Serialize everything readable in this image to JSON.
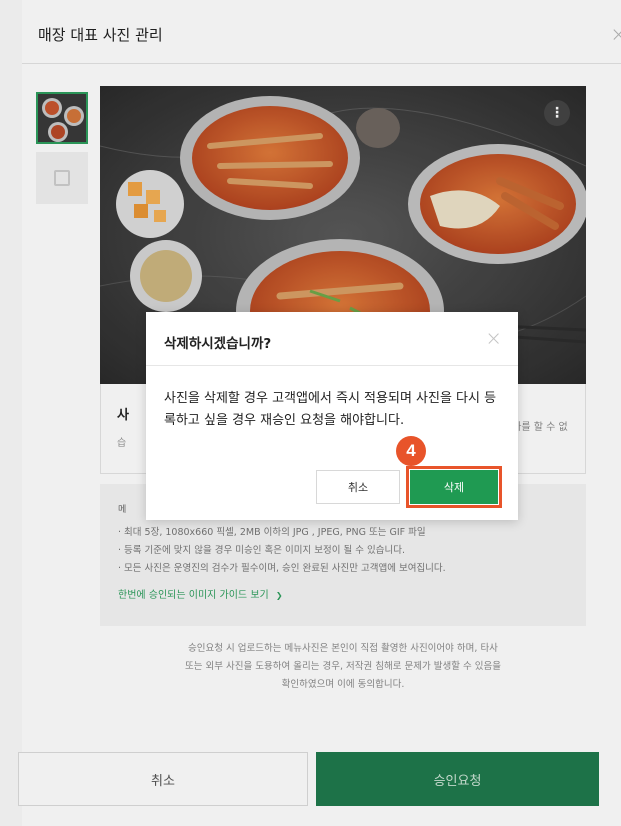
{
  "modal": {
    "title": "매장 대표 사진 관리",
    "close_symbol": "×"
  },
  "photo_info": {
    "title": "사",
    "right_note": "추가를 할 수 없",
    "line": "습"
  },
  "guide": {
    "heading": "메",
    "items": [
      "· 최대 5장, 1080x660 픽셀, 2MB 이하의 JPG , JPEG, PNG 또는 GIF 파일",
      "· 등록 기준에 맞지 않을 경우 미승인 혹은 이미지 보정이 될 수 있습니다.",
      "· 모든 사진은 운영진의 검수가 필수이며, 승인 완료된 사진만 고객앱에 보여집니다."
    ],
    "link_label": "한번에 승인되는 이미지 가이드 보기",
    "link_chevron": "❯"
  },
  "consent": {
    "lines": [
      "승인요청 시 업로드하는 메뉴사진은 본인이 직접 촬영한 사진이어야 하며, 타사",
      "또는 외부 사진을 도용하여 올리는 경우, 저작권 침해로 문제가 발생할 수 있음을",
      "확인하였으며 이에 동의합니다."
    ]
  },
  "footer": {
    "cancel_label": "취소",
    "submit_label": "승인요청"
  },
  "confirm": {
    "title": "삭제하시겠습니까?",
    "message": "사진을 삭제할 경우 고객앱에서 즉시 적용되며 사진을 다시 등록하고 싶을 경우 재승인 요청을 해야합니다.",
    "cancel_label": "취소",
    "delete_label": "삭제",
    "close_symbol": "×",
    "more_symbol": "⋮"
  },
  "step_badge": "4",
  "colors": {
    "accent_green": "#1f9a52",
    "footer_green": "#1f7a4d",
    "highlight_orange": "#e8542a"
  }
}
